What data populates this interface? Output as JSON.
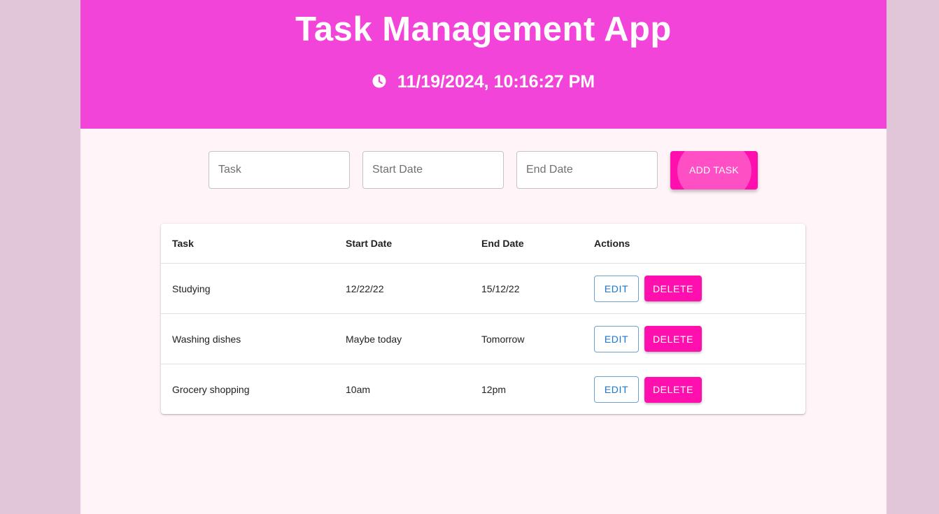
{
  "header": {
    "title": "Task Management App",
    "datetime": "11/19/2024, 10:16:27 PM",
    "clock_icon": "clock-icon"
  },
  "form": {
    "task_placeholder": "Task",
    "start_placeholder": "Start Date",
    "end_placeholder": "End Date",
    "add_label": "ADD TASK"
  },
  "table": {
    "headers": {
      "task": "Task",
      "start": "Start Date",
      "end": "End Date",
      "actions": "Actions"
    },
    "edit_label": "EDIT",
    "delete_label": "DELETE",
    "rows": [
      {
        "task": "Studying",
        "start": "12/22/22",
        "end": "15/12/22"
      },
      {
        "task": "Washing dishes",
        "start": "Maybe today",
        "end": "Tomorrow"
      },
      {
        "task": "Grocery shopping",
        "start": "10am",
        "end": "12pm"
      }
    ]
  },
  "colors": {
    "page_background": "#e0c6d7",
    "app_background": "#fff4f8",
    "header_background": "#f244d8",
    "primary_pink": "#ff0fae",
    "edit_blue": "#1976d2"
  }
}
